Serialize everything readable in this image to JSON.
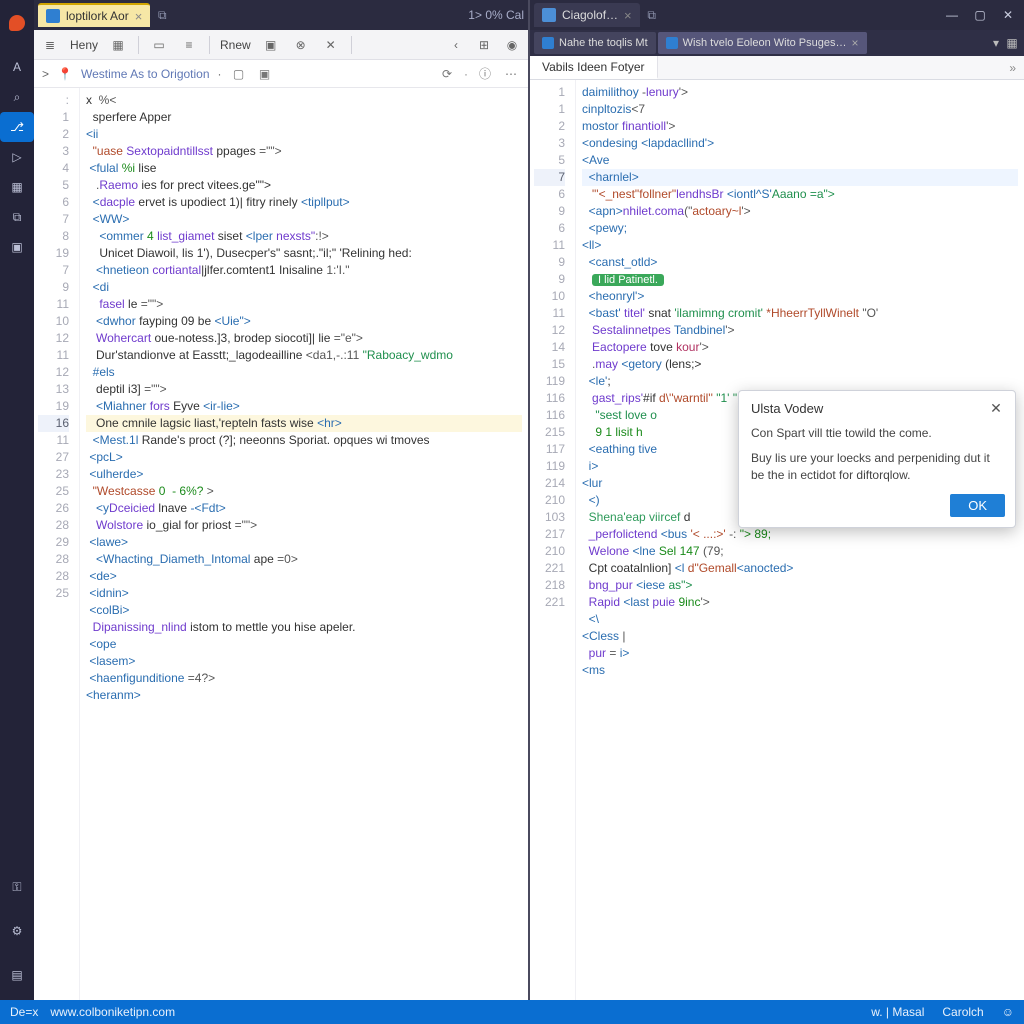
{
  "app": {
    "logo_alt": "App logo"
  },
  "title": {
    "left_tabs": [
      {
        "icon": "file-icon",
        "label": "loptilork Aor",
        "closable": true,
        "active": true
      }
    ],
    "percent_label": "1> 0% Cal",
    "right_tabs": [
      {
        "icon": "file-icon",
        "label": "Ciagolof…",
        "closable": true,
        "active": true
      }
    ],
    "sub_tabs": [
      {
        "icon": "file-icon",
        "label": "Nahe the toqlis Mt",
        "closable": false,
        "active": false
      },
      {
        "icon": "file-icon",
        "label": "Wish tvelo Eoleon Wito Psuges…",
        "closable": true,
        "active": true
      }
    ],
    "inner_tabs": [
      {
        "label": "Vabils Ideen Fotyer",
        "active": true
      }
    ]
  },
  "left_toolbar": {
    "list_icon": "list-icon",
    "name_label": "Heny",
    "grid_icon": "grid-icon",
    "layout_icon": "layout-icon",
    "align_icon": "align-icon",
    "rnew_label": "Rnew",
    "calendar_icon": "calendar-icon",
    "close_icon": "close-icon",
    "x_icon": "x-icon",
    "sep_icon": "separator",
    "back_icon": "chevron-left-icon",
    "table_icon": "table-icon",
    "globe_icon": "globe-icon"
  },
  "left_crumb": {
    "chevron": ">",
    "pin_icon": "pin-icon",
    "text": "Westime As to Origotion",
    "dot": "·",
    "save_icon": "save-icon",
    "open_icon": "open-icon",
    "reload_icon": "reload-icon",
    "info_icon": "info-icon",
    "more_icon": "more-icon"
  },
  "left_code": {
    "line_numbers": [
      ":",
      "1",
      "2",
      "3",
      "4",
      "5",
      "6",
      "7",
      "8",
      "19",
      "7",
      "9",
      "11",
      "10",
      "12",
      "11",
      "12",
      "13",
      "19",
      "16",
      "11",
      "27",
      "23",
      "25",
      "26",
      "28",
      "29",
      "28",
      "28",
      "25"
    ],
    "highlight_index": 19,
    "lines": [
      {
        "raw": "x  <span class='tk-punct'>%&lt;</span>"
      },
      {
        "raw": "  <span class='tk-text'>sperfere Apper</span>"
      },
      {
        "raw": "<span class='tk-tag'>&lt;ii</span>"
      },
      {
        "raw": "  <span class='tk-str'>\"uase</span> <span class='tk-attr'>Sextopaidntillsst</span> <span class='tk-text'>ppages</span> <span class='tk-punct'>=\"\"&gt;</span>"
      },
      {
        "raw": " <span class='tk-tag'>&lt;fulal</span> <span class='tk-num'>%i</span> <span class='tk-text'>lise</span>"
      },
      {
        "raw": "   <span class='tk-punct'>.</span><span class='tk-attr'>Raemo</span> <span class='tk-text'>ies for prect vitees.ge\"\"&gt;</span>"
      },
      {
        "raw": "  <span class='tk-tag'>&lt;</span><span class='tk-attr'>dacple</span> <span class='tk-text'>ervet is upodiect 1)| fitry rinely</span> <span class='tk-tag'>&lt;tipllput&gt;</span>"
      },
      {
        "raw": "  <span class='tk-tag'>&lt;WW&gt;</span>"
      },
      {
        "raw": "    <span class='tk-tag'>&lt;ommer</span> <span class='tk-num'>4</span> <span class='tk-attr'>list_giamet</span> <span class='tk-text'>siset</span> <span class='tk-tag'>&lt;lper</span> <span class='tk-attr'>nexsts\"</span><span class='tk-punct'>:!&gt;</span>"
      },
      {
        "raw": "    <span class='tk-text'>Unicet Diawoil, lis 1'), Dusecper's\" sasnt;.\"il;\" 'Relining hed:</span>"
      },
      {
        "raw": "   <span class='tk-tag'>&lt;hnetieon</span> <span class='tk-attr'>cortiantal</span><span class='tk-text'>|jlfer.comtent1 Inisaline</span> <span class='tk-punct'>1:'I.\"</span>"
      },
      {
        "raw": "  <span class='tk-tag'>&lt;di</span>"
      },
      {
        "raw": "    <span class='tk-attr'>fasel</span> <span class='tk-text'>le</span> <span class='tk-punct'>=\"\"&gt;</span>"
      },
      {
        "raw": "   <span class='tk-tag'>&lt;dwhor</span> <span class='tk-text'>fayping 09 be</span> <span class='tk-tag'>&lt;Uie\"&gt;</span>"
      },
      {
        "raw": "   <span class='tk-attr'>Wohercart</span> <span class='tk-text'>oue-notess.]3, brodep siocoti]| lie</span> <span class='tk-punct'>=\"e\"&gt;</span>"
      },
      {
        "raw": "   <span class='tk-text'>Dur'standionve at Easstt;_lagodeailline</span> <span class='tk-punct'>&lt;da1,-.:11</span> <span class='tk-str2'>\"Raboacy_wdmo</span>"
      },
      {
        "raw": "  <span class='tk-tag'>#els</span>"
      },
      {
        "raw": "   <span class='tk-text'>deptil i3]</span> <span class='tk-punct'>=\"\"&gt;</span>"
      },
      {
        "raw": "   <span class='tk-tag'>&lt;Miahner</span> <span class='tk-attr'>fors</span> <span class='tk-text'>Eyve</span> <span class='tk-tag'>&lt;ir-lie&gt;</span>"
      },
      {
        "raw": "   <span class='tk-text'>One cmnile lagsic liast,'repteln fasts wise</span> <span class='tk-tag'>&lt;hr&gt;</span>"
      },
      {
        "raw": "  <span class='tk-tag'>&lt;Mest.1l</span> <span class='tk-text'>Rande's proct (?]; neeonns Sporiat. opques wi tmoves</span>"
      },
      {
        "raw": " <span class='tk-tag'>&lt;pcL&gt;</span>"
      },
      {
        "raw": " <span class='tk-tag'>&lt;ulherde&gt;</span>"
      },
      {
        "raw": "  <span class='tk-str'>\"Westcasse</span> <span class='tk-num'>0  - 6%?</span> <span class='tk-punct'>&gt;</span>"
      },
      {
        "raw": "   <span class='tk-tag'>&lt;y</span><span class='tk-attr'>Dceicied</span> <span class='tk-text'>lnave</span> <span class='tk-tag'>-&lt;Fdt&gt;</span>"
      },
      {
        "raw": "   <span class='tk-attr'>Wolstore</span> <span class='tk-text'>io_gial for priost</span> <span class='tk-punct'>=\"\"&gt;</span>"
      },
      {
        "raw": " <span class='tk-tag'>&lt;lawe&gt;</span>"
      },
      {
        "raw": "   <span class='tk-tag'>&lt;Whacting_Diameth_Intomal</span> <span class='tk-text'>ape</span> <span class='tk-punct'>=0&gt;</span>"
      },
      {
        "raw": " <span class='tk-tag'>&lt;de&gt;</span>"
      },
      {
        "raw": " <span class='tk-tag'>&lt;idnin&gt;</span>"
      },
      {
        "raw": " <span class='tk-tag'>&lt;colBi&gt;</span>"
      },
      {
        "raw": "  <span class='tk-attr'>Dipanissing_nlind</span> <span class='tk-text'>istom to mettle you hise apeler.</span>"
      },
      {
        "raw": " <span class='tk-tag'>&lt;ope</span>"
      },
      {
        "raw": " <span class='tk-tag'>&lt;lasem&gt;</span>"
      },
      {
        "raw": " <span class='tk-tag'>&lt;haenfigunditione</span> <span class='tk-punct'>=4?&gt;</span>"
      },
      {
        "raw": "<span class='tk-tag'>&lt;heranm&gt;</span>"
      }
    ]
  },
  "right_code": {
    "line_numbers": [
      "1",
      "1",
      "2",
      "3",
      "5",
      "7",
      "6",
      "9",
      "6",
      "11",
      "9",
      "9",
      "10",
      "11",
      "12",
      "14",
      "15",
      "119",
      "116",
      "116",
      "215",
      "117",
      "119",
      "214",
      "210",
      "103",
      "217",
      "210",
      "221",
      "218",
      "221"
    ],
    "highlight_index": 5,
    "lines": [
      {
        "raw": "<span class='tk-tag'>daimilithoy</span> <span class='tk-punct'>-</span><span class='tk-attr'>lenury</span><span class='tk-punct'>'&gt;</span>"
      },
      {
        "raw": "<span class='tk-tag'>cinpltozis</span><span class='tk-punct'>&lt;7</span>"
      },
      {
        "raw": "<span class='tk-tag'>mostor</span> <span class='tk-attr'>finantioll</span><span class='tk-punct'>'&gt;</span>"
      },
      {
        "raw": "<span class='tk-tag'>&lt;ondesing</span> <span class='tk-tag'>&lt;lapdacllind'&gt;</span>"
      },
      {
        "raw": "<span class='tk-tag'>&lt;Ave</span>"
      },
      {
        "raw": "  <span class='tk-tag'>&lt;harnlel&gt;</span>"
      },
      {
        "raw": "   <span class='tk-str'>\"'&lt;_nest\"follner\"</span><span class='tk-attr'>lendhsBr</span> <span class='tk-tag'>&lt;iontl^S'</span><span class='tk-str2'>Aaano =a\"&gt;</span>"
      },
      {
        "raw": "  <span class='tk-tag'>&lt;apn&gt;</span><span class='tk-attr'>nhilet.coma</span><span class='tk-punct'>(\"</span><span class='tk-str'>actoary~l</span><span class='tk-punct'>'&gt;</span>"
      },
      {
        "raw": "  <span class='tk-tag'>&lt;pewy;</span>"
      },
      {
        "raw": "<span class='tk-tag'>&lt;ll&gt;</span>"
      },
      {
        "raw": "  <span class='tk-tag'>&lt;canst_otld&gt;</span>"
      },
      {
        "raw": "   <span class='tk-btnbadge'>I lid Patinetl.</span>"
      },
      {
        "raw": "  <span class='tk-tag'>&lt;heonryl'&gt;</span>"
      },
      {
        "raw": "  <span class='tk-tag'>&lt;bast'</span> <span class='tk-attr'>titel'</span> <span class='tk-text'>snat</span> <span class='tk-str2'>'ilamimng cromit'</span> <span class='tk-str'>*HheerrTyllWinelt</span> <span class='tk-punct'>\"O'</span>"
      },
      {
        "raw": "   <span class='tk-attr'>Sestalinnetpes</span> <span class='tk-tag'>Tandbinel</span><span class='tk-punct'>'&gt;</span>"
      },
      {
        "raw": "   <span class='tk-attr'>Eactopere</span> <span class='tk-text'>tove</span> <span class='tk-key'>kour</span><span class='tk-punct'>'&gt;</span>"
      },
      {
        "raw": "   <span class='tk-punct'>.</span><span class='tk-attr'>may</span> <span class='tk-tag'>&lt;getory</span> <span class='tk-text'>(lens;&gt;</span>"
      },
      {
        "raw": "  <span class='tk-tag'>&lt;le'</span>;"
      },
      {
        "raw": "   <span class='tk-attr'>gast_rips'</span>#<span class='tk-text'>if</span> <span class='tk-str'>d\\''warntil''</span> <span class='tk-str2'>\"1'</span> <span class='tk-str2'>\"..-'</span>"
      },
      {
        "raw": "    <span class='tk-str2'>\"sest love o</span>"
      },
      {
        "raw": "    <span class='tk-num'>9 1 lisit h</span>"
      },
      {
        "raw": "  <span class='tk-tag'>&lt;eathing tive</span>"
      },
      {
        "raw": "  <span class='tk-tag'>i&gt;</span>"
      },
      {
        "raw": "<span class='tk-tag'>&lt;lur</span>"
      },
      {
        "raw": "  <span class='tk-tag'>&lt;)</span>"
      },
      {
        "raw": "  <span class='tk-comm'>Shena'eap viircef</span> <span class='tk-text'>d</span>"
      },
      {
        "raw": "  <span class='tk-attr'>_perfolictend</span> <span class='tk-tag'>&lt;bus</span> <span class='tk-str'>'&lt; ...:&gt;'</span> <span class='tk-punct'>-:</span> <span class='tk-num'>\"&gt;</span> <span class='tk-num'>89;</span>"
      },
      {
        "raw": "  <span class='tk-attr'>Welone</span> <span class='tk-tag'>&lt;lne</span> <span class='tk-num'>Sel</span> <span class='tk-num'>147</span> <span class='tk-punct'>(79;</span>"
      },
      {
        "raw": "  <span class='tk-text'>Cpt coatalnlion]</span> <span class='tk-tag'>&lt;l</span> <span class='tk-str'>d\"Gemall</span><span class='tk-tag'>&lt;anocted&gt;</span>"
      },
      {
        "raw": "  <span class='tk-attr'>bng_pur</span> <span class='tk-tag'>&lt;iese</span> <span class='tk-str2'>as\"&gt;</span>"
      },
      {
        "raw": "  <span class='tk-attr'>Rapid</span> <span class='tk-tag'>&lt;last</span> <span class='tk-attr'>puie</span> <span class='tk-num'>9inc</span><span class='tk-punct'>'&gt;</span>"
      },
      {
        "raw": "  <span class='tk-tag'>&lt;\\</span>"
      },
      {
        "raw": "<span class='tk-tag'>&lt;Cless</span> <span class='tk-punct'>|</span>"
      },
      {
        "raw": "  <span class='tk-attr'>pur</span> <span class='tk-punct'>=</span> <span class='tk-tag'>i&gt;</span>"
      },
      {
        "raw": "<span class='tk-tag'>&lt;ms</span>"
      }
    ]
  },
  "dialog": {
    "title": "Ulsta Vodew",
    "line1": "Con Spart vill ttie towild the come.",
    "line2": "Buy lis ure your loecks and perpeniding dut it be the in ectidot for diftorqlow.",
    "ok": "OK"
  },
  "statusbar": {
    "left1": "De=x",
    "left2": "www.colboniketipn.com",
    "right1": "w. |  Masal",
    "right2": "Carolch"
  },
  "activity_items": [
    {
      "name": "files-icon",
      "glyph": "A",
      "sel": false
    },
    {
      "name": "search-icon",
      "glyph": "⌕",
      "sel": false
    },
    {
      "name": "branch-icon",
      "glyph": "⎇",
      "sel": true
    },
    {
      "name": "run-icon",
      "glyph": "▷",
      "sel": false
    },
    {
      "name": "extensions-icon",
      "glyph": "▦",
      "sel": false
    },
    {
      "name": "clipboard-icon",
      "glyph": "⧉",
      "sel": false
    },
    {
      "name": "book-icon",
      "glyph": "▣",
      "sel": false
    }
  ],
  "activity_bottom": [
    {
      "name": "key-icon",
      "glyph": "⚿"
    },
    {
      "name": "gear-icon",
      "glyph": "⚙"
    },
    {
      "name": "save-icon",
      "glyph": "▤"
    }
  ]
}
